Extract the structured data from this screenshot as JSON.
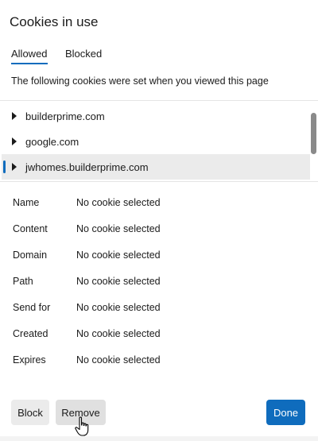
{
  "dialog": {
    "title": "Cookies in use",
    "tabs": [
      {
        "label": "Allowed",
        "selected": true
      },
      {
        "label": "Blocked",
        "selected": false
      }
    ],
    "description": "The following cookies were set when you viewed this page",
    "cookie_tree": [
      {
        "label": "builderprime.com",
        "expanded": false,
        "selected": false
      },
      {
        "label": "google.com",
        "expanded": false,
        "selected": false
      },
      {
        "label": "jwhomes.builderprime.com",
        "expanded": false,
        "selected": true
      }
    ],
    "details": [
      {
        "key": "Name",
        "value": "No cookie selected"
      },
      {
        "key": "Content",
        "value": "No cookie selected"
      },
      {
        "key": "Domain",
        "value": "No cookie selected"
      },
      {
        "key": "Path",
        "value": "No cookie selected"
      },
      {
        "key": "Send for",
        "value": "No cookie selected"
      },
      {
        "key": "Created",
        "value": "No cookie selected"
      },
      {
        "key": "Expires",
        "value": "No cookie selected"
      }
    ],
    "buttons": {
      "block": "Block",
      "remove": "Remove",
      "done": "Done"
    }
  },
  "colors": {
    "accent": "#0f6cbd",
    "selected_row_bg": "#ebebeb",
    "button_bg": "#ebebeb"
  },
  "icons": {
    "expand": "caret-right-icon",
    "cursor": "hand-pointer-icon"
  }
}
